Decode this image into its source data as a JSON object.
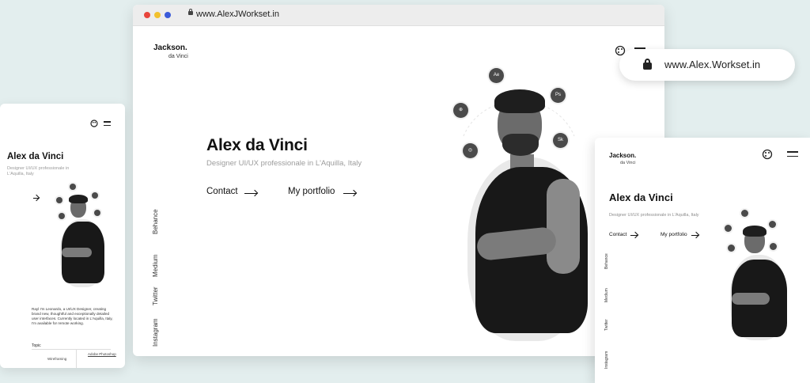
{
  "main_browser": {
    "url": "www.AlexJWorkset.in",
    "brand_name": "Jackson.",
    "brand_sub": "da Vinci",
    "hero_title": "Alex da Vinci",
    "hero_subtitle": "Designer UI/UX professionale in L'Aquilla, Italy",
    "contact_label": "Contact",
    "portfolio_label": "My portfolio",
    "social_links": [
      "Behance",
      "Medium",
      "Twitter",
      "Instagram"
    ],
    "orbit_badges": [
      "Ae",
      "Ps",
      "Sk",
      "⊕",
      "◎"
    ],
    "traffic_lights": [
      "#e8453c",
      "#f2c12e",
      "#3b5bd9"
    ]
  },
  "address_pill": {
    "url": "www.Alex.Workset.in"
  },
  "mobile": {
    "title": "Alex da Vinci",
    "subtitle": "Designer UI/UX professionale in L'Aquilla, Italy",
    "body": "Rayl I'm Leonardo, a UI/UX Designer, creating brand new, thoughtful and exceptionally detailed user interfaces. Currently located in L'Aquilla, Italy, I'm available for remote working.",
    "topic_label": "Topic",
    "topic_item_1": "Wireframing",
    "topic_item_2": "Adobe Photoshop"
  },
  "tablet": {
    "brand_name": "Jackson.",
    "brand_sub": "da Vinci",
    "title": "Alex da Vinci",
    "subtitle": "Designer UI/UX professionale in L'Aquilla, Italy",
    "contact_label": "Contact",
    "portfolio_label": "My portfolio",
    "social_links": [
      "Behance",
      "Medium",
      "Twitter",
      "Instagram"
    ]
  }
}
